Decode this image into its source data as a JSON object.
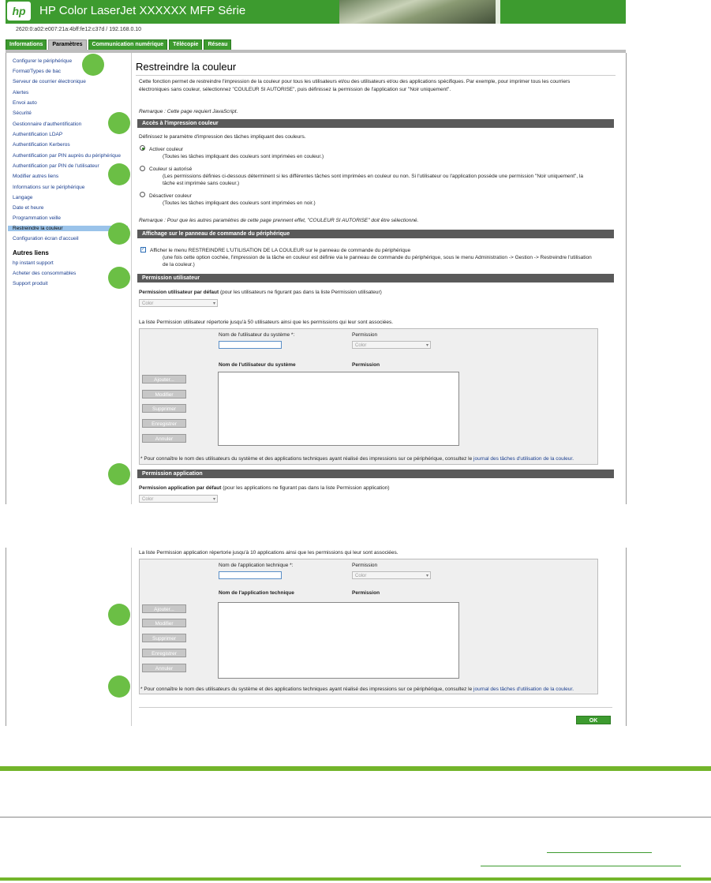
{
  "header": {
    "logo_text": "hp",
    "title": "HP Color LaserJet XXXXXX MFP Série",
    "address": "2620:0:a02:e007:21a:4bff:fe12:c37d / 192.168.0.10"
  },
  "tabs": [
    "Informations",
    "Paramètres",
    "Communication numérique",
    "Télécopie",
    "Réseau"
  ],
  "sidebar": {
    "items": [
      "Configurer le périphérique",
      "Format/Types de bac",
      "Serveur de courrier électronique",
      "Alertes",
      "Envoi auto",
      "Sécurité",
      "Gestionnaire d'authentification",
      "Authentification LDAP",
      "Authentification Kerberos",
      "Authentification par PIN auprès du périphérique",
      "Authentification par PIN de l'utilisateur",
      "Modifier autres liens",
      "Informations sur le périphérique",
      "Langage",
      "Date et heure",
      "Programmation veille",
      "Restreindre la couleur",
      "Configuration écran d'accueil"
    ],
    "other_title": "Autres liens",
    "other_items": [
      "hp instant support",
      "Acheter des consommables",
      "Support produit"
    ]
  },
  "main": {
    "title": "Restreindre la couleur",
    "intro1": "Cette fonction permet de restreindre l'impression de la couleur pour tous les utilisateurs et/ou des utilisateurs et/ou des applications spécifiques. Par exemple, pour imprimer tous les courriers",
    "intro2": "électroniques sans couleur, sélectionnez \"COULEUR SI AUTORISE\", puis définissez la permission de l'application sur \"Noir uniquement\".",
    "remark_js": "Remarque : Cette page requiert JavaScript.",
    "sec_access": "Accès à l'impression couleur",
    "access_desc": "Définissez le paramètre d'impression des tâches impliquant des couleurs.",
    "opt1_label": "Activer couleur",
    "opt1_desc": "(Toutes les tâches impliquant des couleurs sont imprimées en couleur.)",
    "opt2_label": "Couleur si autorisé",
    "opt2_desc1": "(Les permissions définies ci-dessous déterminent si les différentes tâches sont imprimées en couleur ou non. Si l'utilisateur ou l'application possède une permission \"Noir uniquement\", la",
    "opt2_desc2": "tâche est imprimée sans couleur.)",
    "opt3_label": "Désactiver couleur",
    "opt3_desc": "(Toutes les tâches impliquant des couleurs sont imprimées en noir.)",
    "remark_other": "Remarque : Pour que les autres paramètres de cette page prennent effet, \"COULEUR SI AUTORISE\" doit être sélectionné.",
    "sec_display": "Affichage sur le panneau de commande du périphérique",
    "display_chk1": "Afficher le menu RESTREINDRE L'UTILISATION DE LA COULEUR sur le panneau de commande du périphérique",
    "display_chk2": "(une fois cette option cochée, l'impression de la tâche en couleur est définie via le panneau de commande du périphérique, sous le menu Administration -> Gestion -> Restreindre l'utilisation",
    "display_chk3": "de la couleur.)",
    "sec_user": "Permission utilisateur",
    "user_default_bold": "Permission utilisateur par défaut",
    "user_default_rest": "(pour les utilisateurs ne figurant pas dans la liste Permission utilisateur)",
    "select_value": "Color",
    "user_list_note": "La liste Permission utilisateur répertorie jusqu'à 50 utilisateurs ainsi que les permissions qui leur sont associées.",
    "user_name_label": "Nom de l'utilisateur du système *:",
    "permission_label": "Permission",
    "user_col_name": "Nom de l'utilisateur du système",
    "col_permission": "Permission",
    "buttons": [
      "Ajouter...",
      "Modifier",
      "Supprimer",
      "Enregistrer",
      "Annuler"
    ],
    "footnote_pre": "* Pour connaître le nom des utilisateurs du système et des applications techniques ayant réalisé des impressions sur ce périphérique, consultez le ",
    "footnote_link": "journal des tâches d'utilisation de la couleur.",
    "sec_app": "Permission application",
    "app_default_bold": "Permission application par défaut",
    "app_default_rest": "(pour les applications ne figurant pas dans la liste Permission application)",
    "app_list_note": "La liste Permission application répertorie jusqu'à 10 applications ainsi que les permissions qui leur sont associées.",
    "app_name_label": "Nom de l'application technique *:",
    "app_col_name": "Nom de l'application technique",
    "ok_label": "OK"
  }
}
